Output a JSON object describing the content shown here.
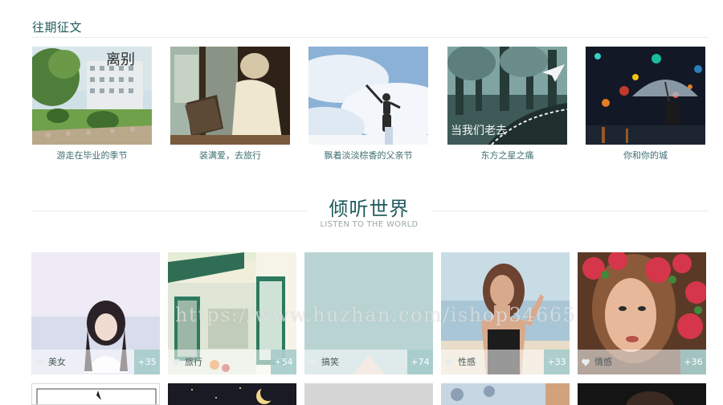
{
  "past_topics": {
    "title": "往期征文",
    "items": [
      {
        "caption": "游走在毕业的季节",
        "overlay_text": "离别"
      },
      {
        "caption": "装满爱，去旅行"
      },
      {
        "caption": "飘着淡淡棕香的父亲节"
      },
      {
        "caption": "东方之星之痛",
        "overlay_text": "当我们老去"
      },
      {
        "caption": "你和你的城"
      }
    ]
  },
  "listen_world": {
    "title": "倾听世界",
    "subtitle": "LISTEN TO THE WORLD",
    "cards": [
      {
        "tag": "美女",
        "count": "+35"
      },
      {
        "tag": "旅行",
        "count": "+54"
      },
      {
        "tag": "搞笑",
        "count": "+74"
      },
      {
        "tag": "性感",
        "count": "+33"
      },
      {
        "tag": "情感",
        "count": "+36"
      }
    ]
  },
  "watermark": "https://www.huzhan.com/ishop34665",
  "colors": {
    "accent": "#1f5a5c",
    "count_badge": "#a0c8c8"
  }
}
